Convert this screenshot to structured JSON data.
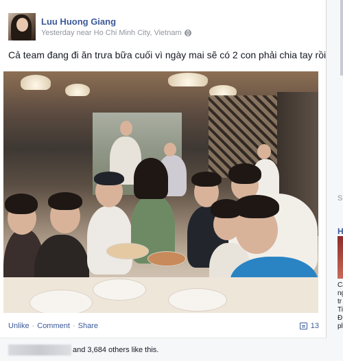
{
  "post": {
    "author": "Luu Huong Giang",
    "timestamp": "Yesterday near Ho Chi Minh City, Vietnam",
    "status": "Cả team đang đi ăn trưa bữa cuối vì ngày mai sẽ có 2 con phải chia tay rồi!"
  },
  "actions": {
    "unlike": "Unlike",
    "separator": "·",
    "comment": "Comment",
    "share": "Share",
    "comment_count": "13"
  },
  "likes": {
    "text": "and 3,684 others like this."
  },
  "sidebar": {
    "heading_fragment": "Sp",
    "link_fragment": "H",
    "text_fragments": [
      "Ca",
      "ng",
      "tr",
      "Ti",
      "Đ",
      "pl"
    ]
  },
  "icons": {
    "privacy": "globe-icon",
    "comments": "comment-bubble-icon"
  },
  "colors": {
    "link": "#3b5998",
    "meta": "#90949c"
  }
}
